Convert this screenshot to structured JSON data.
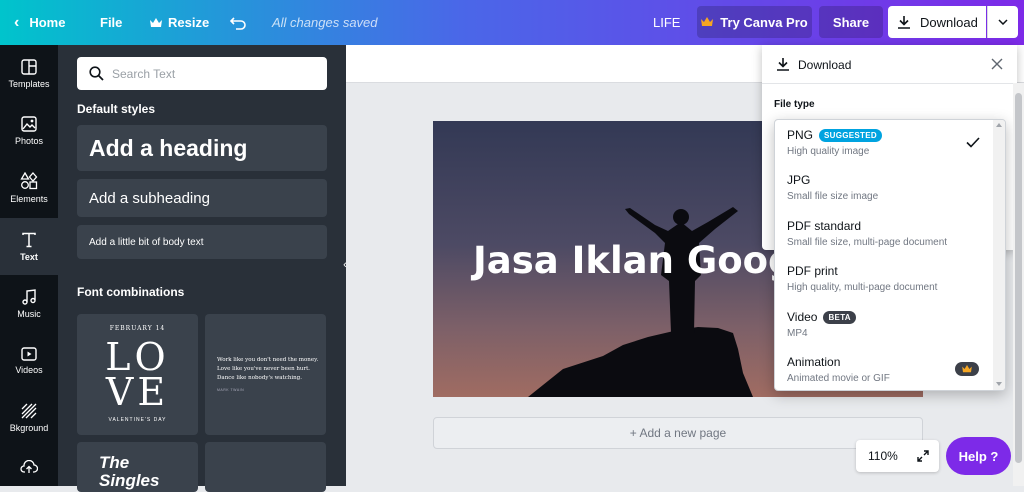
{
  "topbar": {
    "home_label": "Home",
    "file_label": "File",
    "resize_label": "Resize",
    "status": "All changes saved",
    "doc_title": "LIFE",
    "pro_label": "Try Canva Pro",
    "share_label": "Share",
    "download_label": "Download"
  },
  "rail": {
    "items": [
      {
        "label": "Templates",
        "icon": "layout-icon"
      },
      {
        "label": "Photos",
        "icon": "image-icon"
      },
      {
        "label": "Elements",
        "icon": "shapes-icon"
      },
      {
        "label": "Text",
        "icon": "text-icon"
      },
      {
        "label": "Music",
        "icon": "music-icon"
      },
      {
        "label": "Videos",
        "icon": "video-icon"
      },
      {
        "label": "Bkground",
        "icon": "pattern-icon"
      }
    ],
    "active": "Text"
  },
  "panel": {
    "search_placeholder": "Search Text",
    "default_styles_title": "Default styles",
    "heading": "Add a heading",
    "subheading": "Add a subheading",
    "body": "Add a little bit of body text",
    "font_combinations_title": "Font combinations",
    "combo1": {
      "date": "FEBRUARY 14",
      "line1": "LO",
      "line2": "VE",
      "footer": "VALENTINE'S DAY"
    },
    "combo2": {
      "line1": "Work like you don't need the money.",
      "line2": "Love like you've never been hurt.",
      "line3": "Dance like nobody's watching.",
      "footer": "MARK TWAIN"
    },
    "combo3": {
      "line1": "The",
      "line2": "Singles"
    }
  },
  "canvas": {
    "design_text": "Jasa Iklan Google",
    "add_page": "+ Add a new page",
    "zoom": "110%",
    "help": "Help ?"
  },
  "download_panel": {
    "title": "Download",
    "file_type_label": "File type",
    "options": [
      {
        "name": "PNG",
        "badge": "SUGGESTED",
        "desc": "High quality image",
        "selected": true
      },
      {
        "name": "JPG",
        "badge": "",
        "desc": "Small file size image",
        "selected": false
      },
      {
        "name": "PDF standard",
        "badge": "",
        "desc": "Small file size, multi-page document",
        "selected": false
      },
      {
        "name": "PDF print",
        "badge": "",
        "desc": "High quality, multi-page document",
        "selected": false
      },
      {
        "name": "Video",
        "badge": "BETA",
        "desc": "MP4",
        "selected": false
      },
      {
        "name": "Animation",
        "badge": "",
        "desc": "Animated movie or GIF",
        "selected": false
      }
    ]
  },
  "colors": {
    "purple": "#7d2ae8",
    "teal": "#00c4cc",
    "suggested_badge": "#00a3e0",
    "beta_badge": "#3c4049",
    "crown": "#f5a623"
  }
}
